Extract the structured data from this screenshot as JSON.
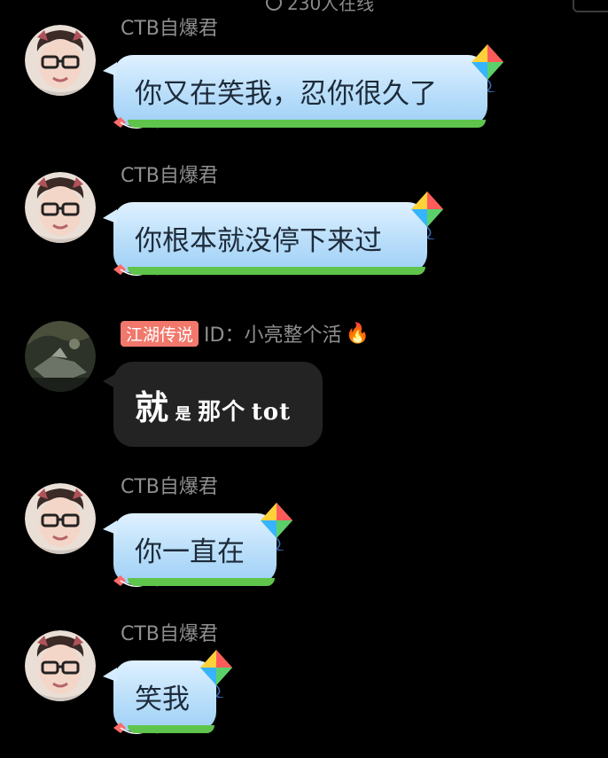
{
  "header": {
    "online_text": "230人在线"
  },
  "messages": [
    {
      "user": "CTB自爆君",
      "text": "你又在笑我，忍你很久了",
      "avatar_icon": "avatar-man-glasses-icon"
    },
    {
      "user": "CTB自爆君",
      "text": "你根本就没停下来过",
      "avatar_icon": "avatar-man-glasses-icon"
    },
    {
      "badge": "江湖传说",
      "user": "ID：小亮整个活",
      "flame": "🔥",
      "text_parts": [
        "就",
        "是",
        "那个",
        "tot"
      ],
      "avatar_icon": "avatar-game-scene-icon"
    },
    {
      "user": "CTB自爆君",
      "text": "你一直在",
      "avatar_icon": "avatar-man-glasses-icon"
    },
    {
      "user": "CTB自爆君",
      "text": "笑我",
      "avatar_icon": "avatar-man-glasses-icon"
    }
  ],
  "colors": {
    "background": "#000000",
    "bubble_blue_top": "#dff1ff",
    "bubble_blue_bottom": "#9fd0f6",
    "bubble_grass": "#5fc44b",
    "bubble_dark": "#232323",
    "badge": "#f1786b",
    "nickname": "#8f8f8f"
  }
}
